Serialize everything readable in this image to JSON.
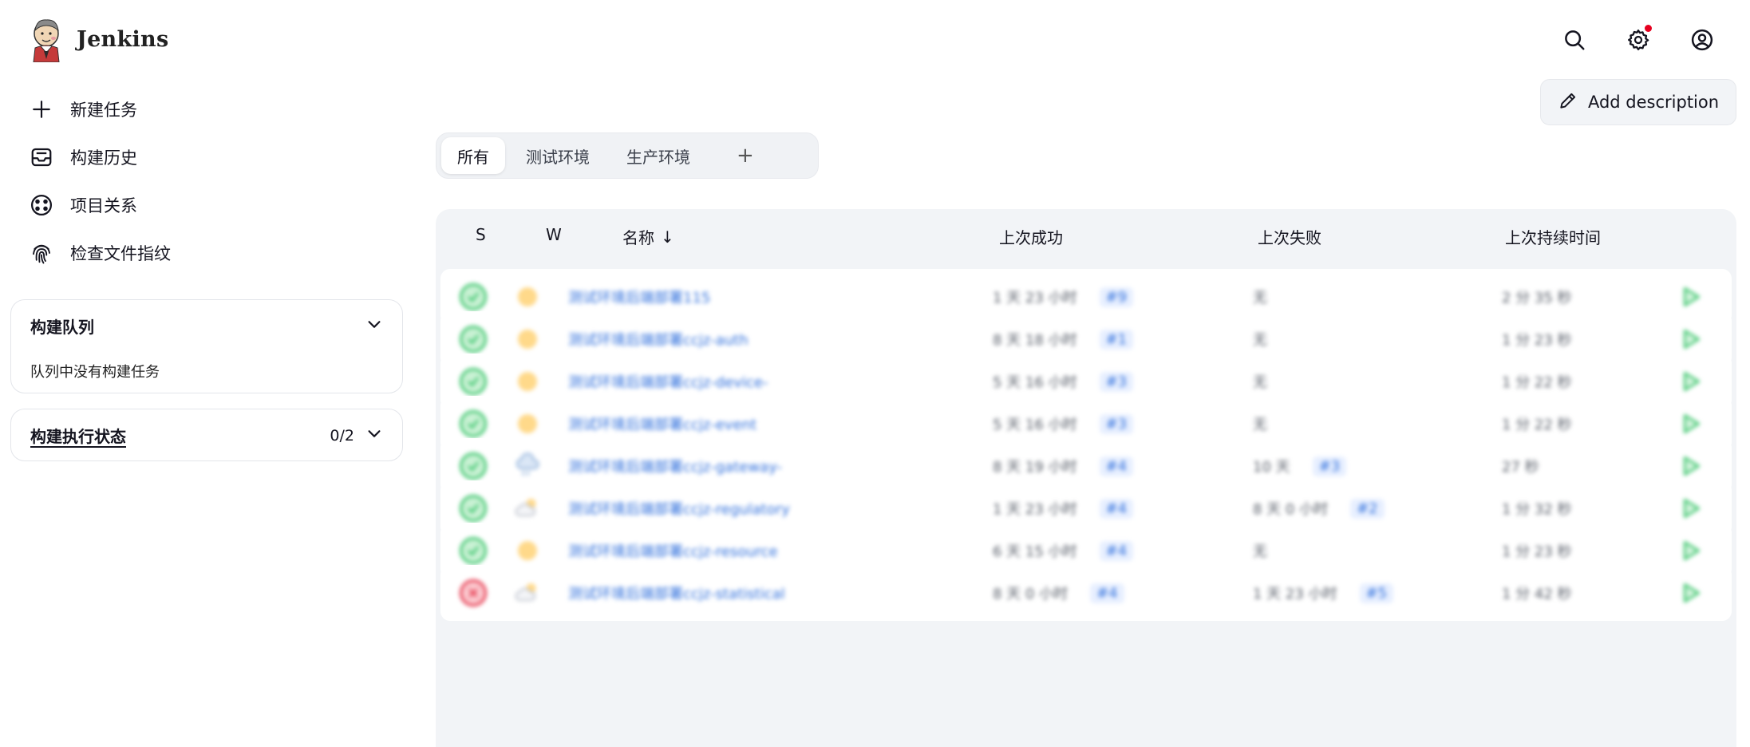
{
  "app": {
    "name": "Jenkins"
  },
  "header": {
    "icons": [
      "search-icon",
      "gear-icon",
      "user-icon"
    ],
    "notification_color": "#e6001f"
  },
  "sidebar": {
    "tasks": [
      {
        "label": "新建任务",
        "icon": "plus-icon"
      },
      {
        "label": "构建历史",
        "icon": "inbox-icon"
      },
      {
        "label": "项目关系",
        "icon": "relationship-icon"
      },
      {
        "label": "检查文件指纹",
        "icon": "fingerprint-icon"
      }
    ],
    "queue": {
      "title": "构建队列",
      "empty_text": "队列中没有构建任务"
    },
    "executors": {
      "title": "构建执行状态",
      "count": "0/2"
    }
  },
  "main": {
    "add_description": "Add description",
    "tabs": [
      {
        "label": "所有",
        "active": true
      },
      {
        "label": "测试环境",
        "active": false
      },
      {
        "label": "生产环境",
        "active": false
      }
    ],
    "tab_add": "+",
    "table": {
      "headers": {
        "s": "S",
        "w": "W",
        "name": "名称",
        "sort_indicator": "↓",
        "last_success": "上次成功",
        "last_failure": "上次失败",
        "last_duration": "上次持续时间"
      },
      "rows": [
        {
          "status": "success",
          "weather": "sun-icon",
          "name": "测试环境后端部署115",
          "last_success": "1 天 23 小时",
          "success_build": "#9",
          "last_failure": "无",
          "failure_build": "",
          "duration": "2 分 35 秒"
        },
        {
          "status": "success",
          "weather": "sun-icon",
          "name": "测试环境后端部署ccjz-auth",
          "last_success": "8 天 18 小时",
          "success_build": "#1",
          "last_failure": "无",
          "failure_build": "",
          "duration": "1 分 23 秒"
        },
        {
          "status": "success",
          "weather": "sun-icon",
          "name": "测试环境后端部署ccjz-device-",
          "last_success": "5 天 16 小时",
          "success_build": "#3",
          "last_failure": "无",
          "failure_build": "",
          "duration": "1 分 22 秒"
        },
        {
          "status": "success",
          "weather": "sun-icon",
          "name": "测试环境后端部署ccjz-event",
          "last_success": "5 天 16 小时",
          "success_build": "#3",
          "last_failure": "无",
          "failure_build": "",
          "duration": "1 分 22 秒"
        },
        {
          "status": "success",
          "weather": "storm-icon",
          "name": "测试环境后端部署ccjz-gateway-",
          "last_success": "8 天 19 小时",
          "success_build": "#4",
          "last_failure": "10 天",
          "failure_build": "#3",
          "duration": "27 秒"
        },
        {
          "status": "success",
          "weather": "cloud-sun-icon",
          "name": "测试环境后端部署ccjz-regulatory",
          "last_success": "1 天 23 小时",
          "success_build": "#4",
          "last_failure": "8 天 0 小时",
          "failure_build": "#2",
          "duration": "1 分 32 秒"
        },
        {
          "status": "success",
          "weather": "sun-icon",
          "name": "测试环境后端部署ccjz-resource",
          "last_success": "6 天 15 小时",
          "success_build": "#4",
          "last_failure": "无",
          "failure_build": "",
          "duration": "1 分 23 秒"
        },
        {
          "status": "failure",
          "weather": "cloud-sun-icon",
          "name": "测试环境后端部署ccjz-statistical",
          "last_success": "8 天 0 小时",
          "success_build": "#4",
          "last_failure": "1 天 23 小时",
          "failure_build": "#5",
          "duration": "1 分 42 秒"
        }
      ]
    }
  },
  "colors": {
    "success": "#39c46a",
    "failure": "#e5344a",
    "link": "#2f6fdc",
    "panel_bg": "#f2f4f7"
  }
}
